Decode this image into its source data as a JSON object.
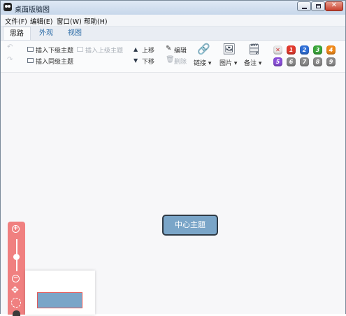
{
  "window": {
    "title": "桌面版脑图"
  },
  "window_controls": {
    "minimize": "minimize",
    "maximize": "maximize",
    "close": "✕"
  },
  "menu": [
    "文件(F)",
    "编辑(E)",
    "窗口(W)",
    "帮助(H)"
  ],
  "tabs": [
    {
      "label": "思路",
      "active": true
    },
    {
      "label": "外观",
      "active": false
    },
    {
      "label": "视图",
      "active": false
    }
  ],
  "toolbar": {
    "undo": "undo",
    "redo": "redo",
    "insert_child": "插入下级主题",
    "insert_parent": "插入上级主题",
    "insert_sibling": "插入同级主题",
    "move_up": "上移",
    "move_down": "下移",
    "edit": "编辑",
    "delete": "删除",
    "link": "链接",
    "image": "图片",
    "note": "备注",
    "dropdown_caret": "▾",
    "priorities": [
      {
        "label": "✕",
        "color": "#e8e8e8",
        "text_color": "#d03030"
      },
      {
        "label": "1",
        "color": "#e23a2e"
      },
      {
        "label": "2",
        "color": "#2f6fd6"
      },
      {
        "label": "3",
        "color": "#3aa63a"
      },
      {
        "label": "4",
        "color": "#f08a1a"
      },
      {
        "label": "5",
        "color": "#8a4fd8"
      },
      {
        "label": "6",
        "color": "#8a8a8a"
      },
      {
        "label": "7",
        "color": "#8a8a8a"
      },
      {
        "label": "8",
        "color": "#8a8a8a"
      },
      {
        "label": "9",
        "color": "#8a8a8a"
      }
    ]
  },
  "canvas": {
    "central_topic": "中心主题"
  },
  "zoom": {
    "in": "+",
    "out": "−",
    "move": "✥"
  }
}
